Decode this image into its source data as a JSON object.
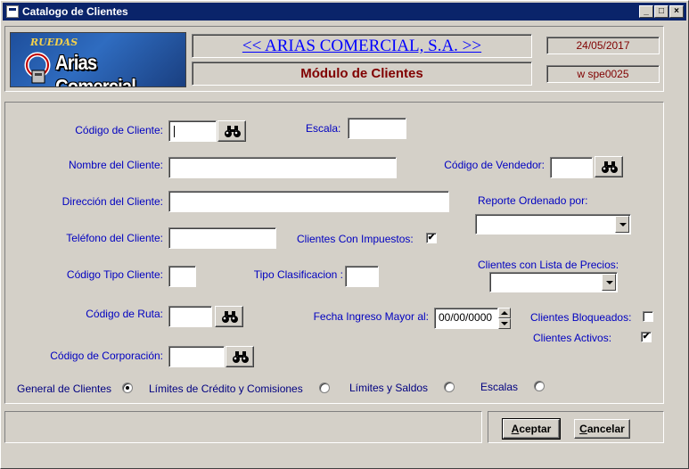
{
  "window": {
    "title": "Catalogo de Clientes",
    "minimize": "_",
    "maximize": "□",
    "close": "×"
  },
  "header": {
    "logo_top": "RUEDAS",
    "logo_brand": "Arias Comercial",
    "company": "<< ARIAS COMERCIAL, S.A. >>",
    "module": "Módulo de Clientes",
    "date": "24/05/2017",
    "user": "w  spe0025"
  },
  "form": {
    "codigo_cliente_label": "Código de Cliente:",
    "codigo_cliente_value": "",
    "escala_label": "Escala:",
    "escala_value": "",
    "nombre_label": "Nombre del Cliente:",
    "nombre_value": "",
    "vendedor_label": "Código de Vendedor:",
    "vendedor_value": "",
    "direccion_label": "Dirección del Cliente:",
    "direccion_value": "",
    "reporte_label": "Reporte Ordenado por:",
    "reporte_value": "",
    "telefono_label": "Teléfono del Cliente:",
    "telefono_value": "",
    "impuestos_label": "Clientes Con Impuestos:",
    "impuestos_checked": "✔",
    "tipo_cliente_label": "Código Tipo Cliente:",
    "tipo_cliente_value": "",
    "tipo_clasif_label": "Tipo Clasificacion :",
    "tipo_clasif_value": "",
    "lista_precios_label": "Clientes con Lista de Precios:",
    "lista_precios_value": "",
    "ruta_label": "Código de Ruta:",
    "ruta_value": "",
    "fecha_label": "Fecha Ingreso Mayor al:",
    "fecha_value": "00/00/0000",
    "bloqueados_label": "Clientes Bloqueados:",
    "bloqueados_checked": "",
    "activos_label": "Clientes Activos:",
    "activos_checked": "✔",
    "corporacion_label": "Código de Corporación:",
    "corporacion_value": ""
  },
  "report_options": [
    {
      "label": "General de Clientes",
      "selected": true
    },
    {
      "label": "Límites de Crédito y Comisiones",
      "selected": false
    },
    {
      "label": "Límites y Saldos",
      "selected": false
    },
    {
      "label": "Escalas",
      "selected": false
    }
  ],
  "footer": {
    "accept_first": "A",
    "accept_rest": "ceptar",
    "cancel_first": "C",
    "cancel_rest": "ancelar"
  },
  "colors": {
    "titlebar": "#0a246a",
    "label_blue": "#0000c0",
    "maroon": "#800000",
    "face": "#d4d0c8"
  },
  "icons": {
    "search": "binoculars-icon"
  }
}
